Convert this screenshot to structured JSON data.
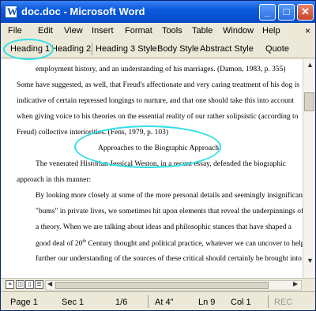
{
  "window": {
    "title": "doc.doc - Microsoft Word",
    "minimize": "_",
    "maximize": "□",
    "close": "✕"
  },
  "menubar": {
    "items": [
      "File",
      "Edit",
      "View",
      "Insert",
      "Format",
      "Tools",
      "Table",
      "Window",
      "Help"
    ],
    "close_doc": "×"
  },
  "stylebar": {
    "items": [
      "Heading 1",
      "Heading 2",
      "Heading 3 Style",
      "Body Style",
      "Abstract Style",
      "Quote"
    ]
  },
  "document": {
    "lines": [
      "employment history, and an understanding of his marriages. (Damon, 1983, p. 355)",
      "Some have suggested, as well, that Freud's affectionate and very caring treatment of his dog is",
      "indicative of certain repressed longings to nurture, and that one should take this into account",
      "when giving voice to his theories on the essential reality of our rather solipsistic (according to",
      "Freud) collective interiorities. (Fens, 1979, p. 103)",
      "Approaches to the Biographic Approach.",
      "The venerated Historian Jessical Weston, in a recent essay, defended the biographic",
      "approach in this manner:",
      "By looking more closely at some of the more personal details and seemingly insignificant",
      "\"bums\" in private lives, we sometimes hit upon elements that reveal the underpinnings of",
      "a theory. When we are talking about ideas and philosophic stances that have shaped a",
      "good deal of 20",
      "th",
      " Century thought and political practice, whatever we can uncover to help",
      "further our understanding of the sources of these critical should certainly be brought into"
    ]
  },
  "statusbar": {
    "page": "Page 1",
    "sec": "Sec 1",
    "pages": "1/6",
    "at": "At 4\"",
    "ln": "Ln 9",
    "col": "Col 1",
    "rec": "REC"
  },
  "colors": {
    "title_bar": "#0a5ade",
    "callout": "#2ee0e8",
    "chrome": "#ece9d8"
  }
}
